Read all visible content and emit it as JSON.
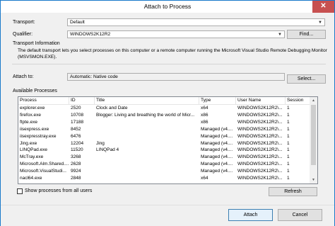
{
  "window": {
    "title": "Attach to Process",
    "close_glyph": "✕"
  },
  "transport": {
    "label": "Transport:",
    "value": "Default"
  },
  "qualifier": {
    "label": "Qualifier:",
    "value": "WINDOWS2K12R2",
    "find_button": "Find..."
  },
  "transport_info": {
    "heading": "Transport Information",
    "text": "The default transport lets you select processes on this computer or a remote computer running the Microsoft Visual Studio Remote Debugging Monitor (MSVSMON.EXE)."
  },
  "attach_to": {
    "label": "Attach to:",
    "value": "Automatic: Native code",
    "select_button": "Select..."
  },
  "processes": {
    "heading": "Available Processes",
    "columns": [
      "Process",
      "ID",
      "Title",
      "Type",
      "User Name",
      "Session"
    ],
    "rows": [
      [
        "explorer.exe",
        "2520",
        "Clock and Date",
        "x64",
        "WINDOWS2K12R2\\...",
        "1"
      ],
      [
        "firefox.exe",
        "10708",
        "Blogger: Living and breathing the world of Micr...",
        "x86",
        "WINDOWS2K12R2\\...",
        "1"
      ],
      [
        "ftpte.exe",
        "17188",
        "",
        "x86",
        "WINDOWS2K12R2\\...",
        "1"
      ],
      [
        "iisexpress.exe",
        "8452",
        "",
        "Managed (v4....",
        "WINDOWS2K12R2\\...",
        "1"
      ],
      [
        "iisexpresstray.exe",
        "6476",
        "",
        "Managed (v4....",
        "WINDOWS2K12R2\\...",
        "1"
      ],
      [
        "Jing.exe",
        "12204",
        "Jing",
        "Managed (v4....",
        "WINDOWS2K12R2\\...",
        "1"
      ],
      [
        "LINQPad.exe",
        "11520",
        "LINQPad 4",
        "Managed (v4....",
        "WINDOWS2K12R2\\...",
        "1"
      ],
      [
        "McTray.exe",
        "3268",
        "",
        "Managed (v4....",
        "WINDOWS2K12R2\\...",
        "1"
      ],
      [
        "Microsoft.Alm.Shared....",
        "2628",
        "",
        "Managed (v4....",
        "WINDOWS2K12R2\\...",
        "1"
      ],
      [
        "Microsoft.VisualStudi...",
        "9924",
        "",
        "Managed (v4....",
        "WINDOWS2K12R2\\...",
        "1"
      ],
      [
        "nacl64.exe",
        "2848",
        "",
        "x64",
        "WINDOWS2K12R2\\...",
        "1"
      ]
    ],
    "show_all_label": "Show processes from all users",
    "show_all_checked": false,
    "refresh_button": "Refresh"
  },
  "footer": {
    "attach_button": "Attach",
    "cancel_button": "Cancel"
  }
}
